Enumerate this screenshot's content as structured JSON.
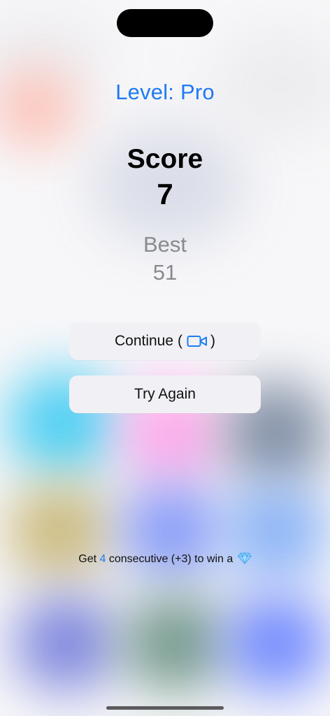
{
  "header": {
    "level_text": "Level: Pro"
  },
  "score": {
    "label": "Score",
    "value": "7"
  },
  "best": {
    "label": "Best",
    "value": "51"
  },
  "actions": {
    "continue_label": "Continue",
    "continue_open": "(",
    "continue_close": ")",
    "continue_icon": "video-camera-icon",
    "try_again_label": "Try Again"
  },
  "hint": {
    "prefix": "Get",
    "count": "4",
    "suffix": "consecutive (+3) to win a",
    "icon": "gem-icon"
  },
  "colors": {
    "accent": "#1e7bf2",
    "muted": "#8a8a8e",
    "button_bg": "#f1f1f5"
  }
}
